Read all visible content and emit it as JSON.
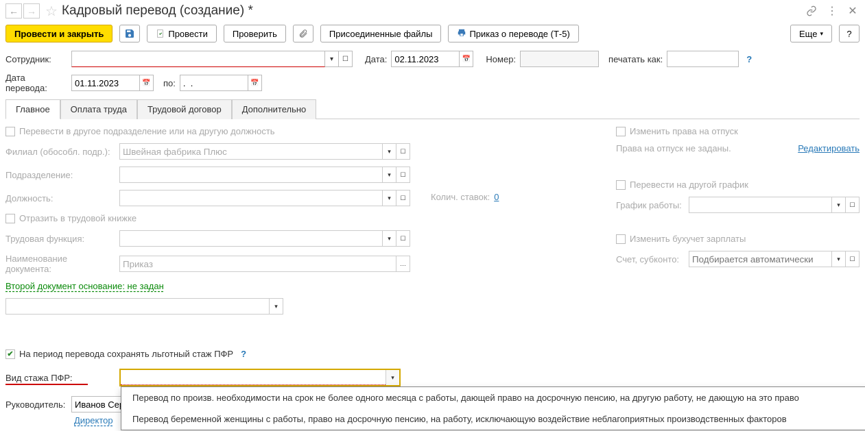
{
  "title": "Кадровый перевод (создание) *",
  "toolbar": {
    "post_close": "Провести и закрыть",
    "post": "Провести",
    "check": "Проверить",
    "attached_files": "Присоединенные файлы",
    "order_t5": "Приказ о переводе (Т-5)",
    "more": "Еще",
    "help": "?"
  },
  "row1": {
    "employee_label": "Сотрудник:",
    "date_label": "Дата:",
    "date_value": "02.11.2023",
    "number_label": "Номер:",
    "print_as_label": "печатать как:",
    "help": "?"
  },
  "row2": {
    "transfer_date_label": "Дата перевода:",
    "transfer_date_value": "01.11.2023",
    "to_label": "по:",
    "to_value": ".  .    "
  },
  "tabs": [
    "Главное",
    "Оплата труда",
    "Трудовой договор",
    "Дополнительно"
  ],
  "main": {
    "transfer_dept_check": "Перевести в другое подразделение или на другую должность",
    "branch_label": "Филиал (обособл. подр.):",
    "branch_value": "Швейная фабрика Плюс",
    "dept_label": "Подразделение:",
    "position_label": "Должность:",
    "rates_label": "Колич. ставок:",
    "rates_value": "0",
    "record_book_check": "Отразить в трудовой книжке",
    "labor_func_label": "Трудовая функция:",
    "doc_name_label": "Наименование документа:",
    "doc_name_value": "Приказ",
    "second_doc_link": "Второй документ основание: не задан",
    "change_vacation_check": "Изменить права на отпуск",
    "vacation_text": "Права на отпуск не заданы.",
    "edit_link": "Редактировать",
    "transfer_schedule_check": "Перевести на другой график",
    "schedule_label": "График работы:",
    "change_payroll_check": "Изменить бухучет зарплаты",
    "account_label": "Счет, субконто:",
    "account_placeholder": "Подбирается автоматически"
  },
  "pfr": {
    "keep_pref_check": "На период перевода сохранять льготный стаж ПФР",
    "help": "?",
    "type_label": "Вид стажа ПФР:",
    "type_value": "",
    "options": [
      "Перевод по произв. необходимости на срок не более одного месяца с работы, дающей право на досрочную пенсию, на другую работу, не дающую на это право",
      "Перевод беременной женщины с работы, право на досрочную пенсию, на работу, исключающую воздействие неблагоприятных производственных факторов"
    ]
  },
  "footer": {
    "manager_label": "Руководитель:",
    "manager_value": "Иванов Серг",
    "director_link": "Директор"
  }
}
